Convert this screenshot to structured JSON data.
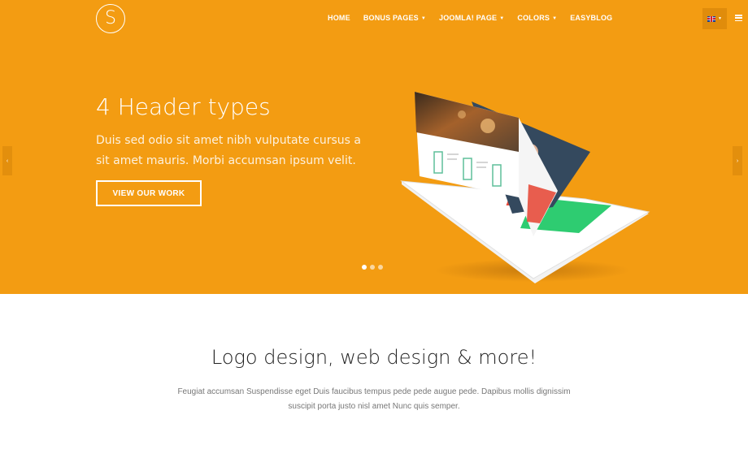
{
  "header": {
    "logo_letter": "S",
    "nav": [
      {
        "label": "HOME",
        "has_dropdown": false
      },
      {
        "label": "BONUS PAGES",
        "has_dropdown": true
      },
      {
        "label": "JOOMLA! PAGE",
        "has_dropdown": true
      },
      {
        "label": "COLORS",
        "has_dropdown": true
      },
      {
        "label": "EASYBLOG",
        "has_dropdown": false
      }
    ],
    "caret": "▼",
    "language_icon": "uk-flag-icon",
    "menu_icon": "hamburger-icon"
  },
  "slider": {
    "title": "4 Header types",
    "text": "Duis sed odio sit amet nibh vulputate cursus a sit amet mauris. Morbi accumsan ipsum velit.",
    "button_label": "VIEW OUR WORK",
    "prev_arrow": "‹",
    "next_arrow": "›",
    "slide_count": 3,
    "active_slide": 1
  },
  "colors": {
    "accent": "#f39c12",
    "text_dark": "#222222",
    "text_muted": "#777777"
  },
  "section": {
    "title": "Logo design, web design & more!",
    "text": "Feugiat accumsan Suspendisse eget Duis faucibus tempus pede pede augue pede. Dapibus mollis dignissim suscipit porta justo nisl amet Nunc quis semper."
  }
}
